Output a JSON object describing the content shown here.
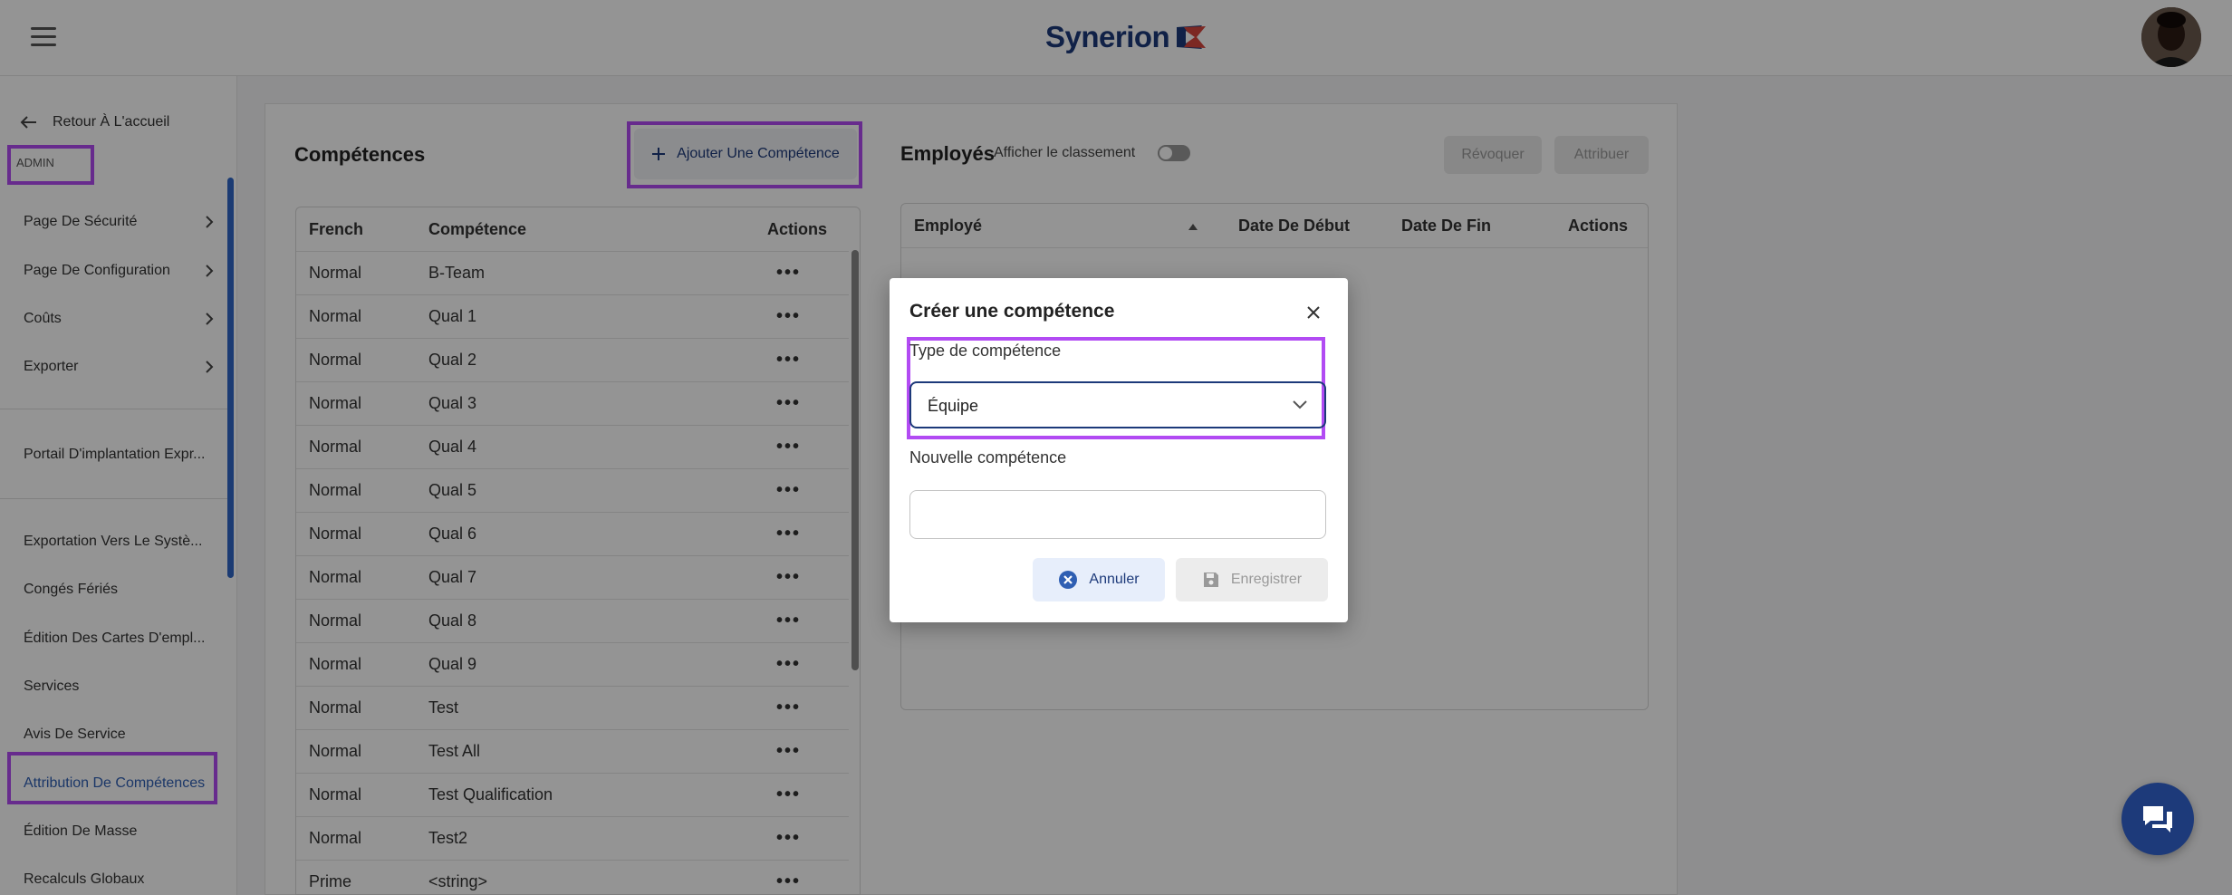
{
  "header": {
    "brand": "Synerion",
    "menu_icon": "hamburger-menu-icon",
    "avatar_icon": "user-avatar"
  },
  "sidebar": {
    "back_label": "Retour À L'accueil",
    "section_label": "ADMIN",
    "group_items": [
      {
        "label": "Page De Sécurité"
      },
      {
        "label": "Page De Configuration"
      },
      {
        "label": "Coûts"
      },
      {
        "label": "Exporter"
      }
    ],
    "portal_item": "Portail D'implantation Expr...",
    "items": [
      {
        "label": "Exportation Vers Le Systè..."
      },
      {
        "label": "Congés Fériés"
      },
      {
        "label": "Édition Des Cartes D'empl..."
      },
      {
        "label": "Services"
      },
      {
        "label": "Avis De Service"
      },
      {
        "label": "Attribution De Compétences"
      },
      {
        "label": "Édition De Masse"
      },
      {
        "label": "Recalculs Globaux"
      }
    ]
  },
  "competences": {
    "title": "Compétences",
    "add_button": "Ajouter Une Compétence",
    "columns": [
      "French",
      "Compétence",
      "Actions"
    ],
    "rows": [
      {
        "type": "Normal",
        "name": "B-Team",
        "actions": "•••"
      },
      {
        "type": "Normal",
        "name": "Qual 1",
        "actions": "•••"
      },
      {
        "type": "Normal",
        "name": "Qual 2",
        "actions": "•••"
      },
      {
        "type": "Normal",
        "name": "Qual 3",
        "actions": "•••"
      },
      {
        "type": "Normal",
        "name": "Qual 4",
        "actions": "•••"
      },
      {
        "type": "Normal",
        "name": "Qual 5",
        "actions": "•••"
      },
      {
        "type": "Normal",
        "name": "Qual 6",
        "actions": "•••"
      },
      {
        "type": "Normal",
        "name": "Qual 7",
        "actions": "•••"
      },
      {
        "type": "Normal",
        "name": "Qual 8",
        "actions": "•••"
      },
      {
        "type": "Normal",
        "name": "Qual 9",
        "actions": "•••"
      },
      {
        "type": "Normal",
        "name": "Test",
        "actions": "•••"
      },
      {
        "type": "Normal",
        "name": "Test All",
        "actions": "•••"
      },
      {
        "type": "Normal",
        "name": "Test Qualification",
        "actions": "•••"
      },
      {
        "type": "Normal",
        "name": "Test2",
        "actions": "•••"
      },
      {
        "type": "Prime",
        "name": "<string>",
        "actions": "•••"
      }
    ]
  },
  "employes": {
    "title": "Employés",
    "toggle_label": "Afficher le classement",
    "toggle_on": false,
    "revoke_button": "Révoquer",
    "assign_button": "Attribuer",
    "columns": [
      "Employé",
      "Date De Début",
      "Date De Fin",
      "Actions"
    ]
  },
  "modal": {
    "title": "Créer une compétence",
    "type_label": "Type de compétence",
    "type_value": "Équipe",
    "new_label": "Nouvelle compétence",
    "new_value": "",
    "cancel_button": "Annuler",
    "save_button": "Enregistrer"
  },
  "colors": {
    "brand_navy": "#1d3a7a",
    "highlight": "#b24bf3",
    "brand_red": "#d6453d"
  },
  "chat_icon": "chat-bubble-icon"
}
